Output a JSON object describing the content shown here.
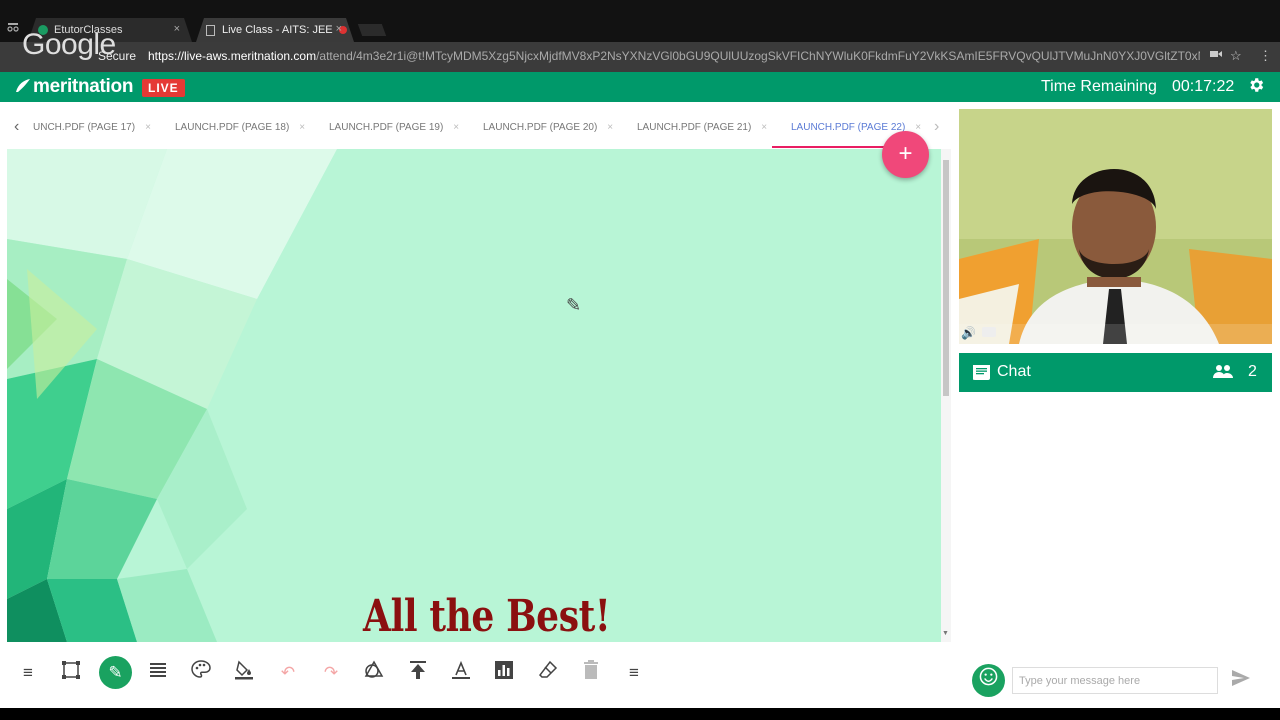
{
  "browser": {
    "tabs": [
      {
        "title": "EtutorClasses",
        "close": "×"
      },
      {
        "title": "Live Class - AITS: JEE",
        "close": "×"
      }
    ],
    "watermark": "Google",
    "secure_label": "Secure",
    "url_host": "https://live-aws.meritnation.com",
    "url_path": "/attend/4m3e2r1i@t!MTcyMDM5Xzg5NjcxMjdfMV8xP2NsYXNzVGl0bGU9QUlUUzogSkVFIChNYWluK0FkdmFuY2VkKSAmIE5FRVQvQUlJTVMuJnN0YXJ0VGltZT0xNTM5Njky..."
  },
  "header": {
    "logo": "meritnation",
    "live_badge": "LIVE",
    "time_label": "Time Remaining",
    "time_value": "00:17:22"
  },
  "doc_tabs": {
    "items": [
      {
        "label": "UNCH.PDF (PAGE 17)"
      },
      {
        "label": "LAUNCH.PDF (PAGE 18)"
      },
      {
        "label": "LAUNCH.PDF (PAGE 19)"
      },
      {
        "label": "LAUNCH.PDF (PAGE 20)"
      },
      {
        "label": "LAUNCH.PDF (PAGE 21)"
      },
      {
        "label": "LAUNCH.PDF (PAGE 22)"
      }
    ],
    "close_glyph": "×",
    "active_index": 5
  },
  "slide": {
    "text": "All the Best!",
    "background": "#b8f5d6",
    "text_color": "#8b1010"
  },
  "fab_label": "+",
  "chat": {
    "title": "Chat",
    "participant_count": "2",
    "placeholder": "Type your message here"
  },
  "colors": {
    "brand_green": "#00996a",
    "live_red": "#e53935",
    "fab_pink": "#f0487a",
    "active_tab": "#5b7bd5"
  }
}
